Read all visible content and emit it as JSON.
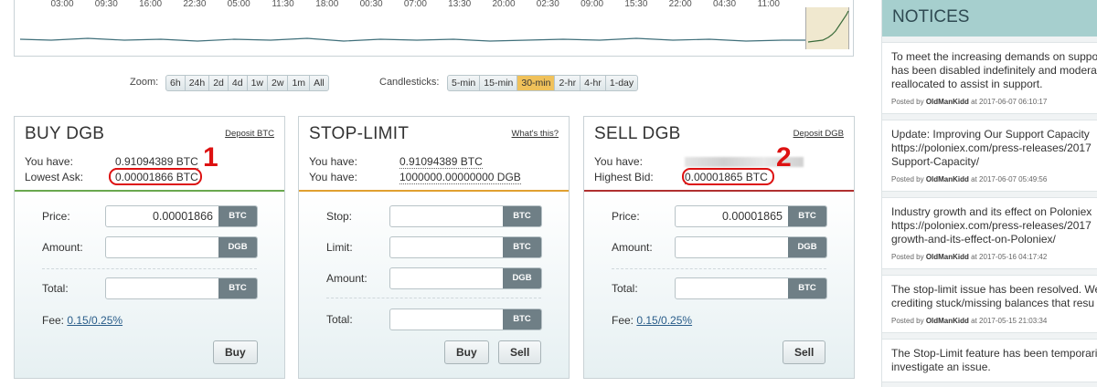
{
  "chart": {
    "times": [
      "03:00",
      "09:30",
      "16:00",
      "22:30",
      "05:00",
      "11:30",
      "18:00",
      "00:30",
      "07:00",
      "13:30",
      "20:00",
      "02:30",
      "09:00",
      "15:30",
      "22:00",
      "04:30",
      "11:00"
    ]
  },
  "controls": {
    "zoom_label": "Zoom:",
    "zoom": [
      "6h",
      "24h",
      "2d",
      "4d",
      "1w",
      "2w",
      "1m",
      "All"
    ],
    "candles_label": "Candlesticks:",
    "candles": [
      "5-min",
      "15-min",
      "30-min",
      "2-hr",
      "4-hr",
      "1-day"
    ],
    "candles_active": "30-min"
  },
  "buy": {
    "title": "BUY DGB",
    "link": "Deposit BTC",
    "you_have_label": "You have:",
    "you_have": "0.91094389 BTC",
    "ask_label": "Lowest Ask:",
    "ask": "0.00001866 BTC",
    "annotation": "1",
    "price_label": "Price:",
    "price": "0.00001866",
    "price_cur": "BTC",
    "amount_label": "Amount:",
    "amount_cur": "DGB",
    "total_label": "Total:",
    "total_cur": "BTC",
    "fee_label": "Fee:",
    "fee": "0.15/0.25%",
    "buy_btn": "Buy"
  },
  "stop": {
    "title": "STOP-LIMIT",
    "link": "What's this?",
    "you_have_label": "You have:",
    "you_have_btc": "0.91094389 BTC",
    "you_have_label2": "You have:",
    "you_have_dgb": "1000000.00000000 DGB",
    "stop_label": "Stop:",
    "stop_cur": "BTC",
    "limit_label": "Limit:",
    "limit_cur": "BTC",
    "amount_label": "Amount:",
    "amount_cur": "DGB",
    "total_label": "Total:",
    "total_cur": "BTC",
    "buy_btn": "Buy",
    "sell_btn": "Sell"
  },
  "sell": {
    "title": "SELL DGB",
    "link": "Deposit DGB",
    "you_have_label": "You have:",
    "bid_label": "Highest Bid:",
    "bid": "0.00001865 BTC",
    "annotation": "2",
    "price_label": "Price:",
    "price": "0.00001865",
    "price_cur": "BTC",
    "amount_label": "Amount:",
    "amount_cur": "DGB",
    "total_label": "Total:",
    "total_cur": "BTC",
    "fee_label": "Fee:",
    "fee": "0.15/0.25%",
    "sell_btn": "Sell"
  },
  "notices": {
    "title": "NOTICES",
    "items": [
      {
        "text": "To meet the increasing demands on support\nhas been disabled indefinitely and moderat\nreallocated to assist in support.",
        "by": "Posted by ",
        "author": "OldManKidd",
        "at": " at 2017-06-07 06:10:17"
      },
      {
        "text": "Update: Improving Our Support Capacity\nhttps://poloniex.com/press-releases/2017\nSupport-Capacity/",
        "by": "Posted by ",
        "author": "OldManKidd",
        "at": " at 2017-06-07 05:49:56"
      },
      {
        "text": "Industry growth and its effect on Poloniex\nhttps://poloniex.com/press-releases/2017\ngrowth-and-its-effect-on-Poloniex/",
        "by": "Posted by ",
        "author": "OldManKidd",
        "at": " at 2017-05-16 04:17:42"
      },
      {
        "text": "The stop-limit issue has been resolved. We\ncrediting stuck/missing balances that resu",
        "by": "Posted by ",
        "author": "OldManKidd",
        "at": " at 2017-05-15 21:03:34"
      },
      {
        "text": "The Stop-Limit feature has been temporari\ninvestigate an issue.",
        "by": "",
        "author": "",
        "at": ""
      }
    ]
  }
}
